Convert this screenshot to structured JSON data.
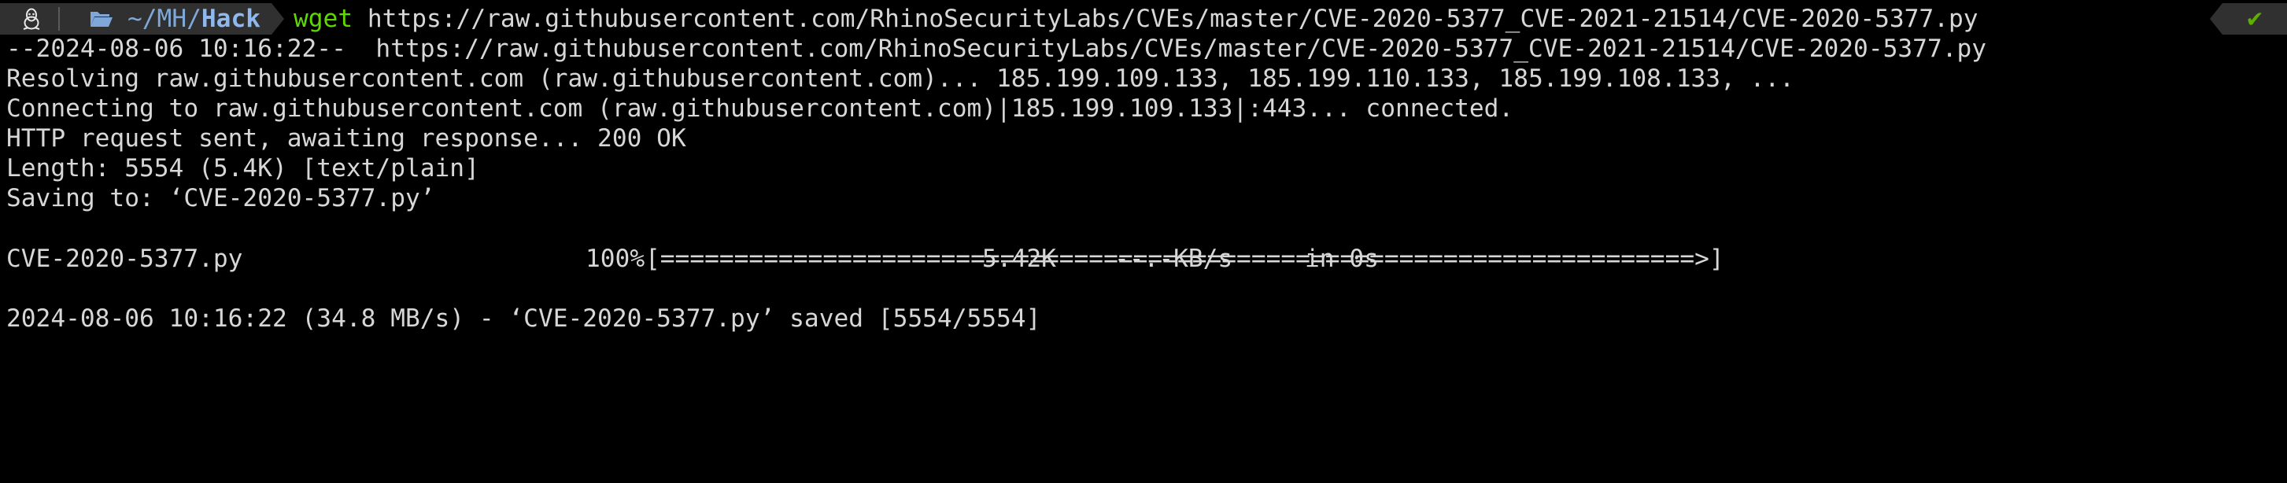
{
  "prompt": {
    "dir_prefix": "~/MH/",
    "dir_current": "Hack",
    "command": "wget",
    "argument": "https://raw.githubusercontent.com/RhinoSecurityLabs/CVEs/master/CVE-2020-5377_CVE-2021-21514/CVE-2020-5377.py",
    "status_icon": "checkmark-icon",
    "status_glyph": "✔",
    "os_icon": "linux-tux-icon",
    "folder_icon": "folder-open-icon"
  },
  "output": {
    "line1": "--2024-08-06 10:16:22--  https://raw.githubusercontent.com/RhinoSecurityLabs/CVEs/master/CVE-2020-5377_CVE-2021-21514/CVE-2020-5377.py",
    "line2": "Resolving raw.githubusercontent.com (raw.githubusercontent.com)... 185.199.109.133, 185.199.110.133, 185.199.108.133, ...",
    "line3": "Connecting to raw.githubusercontent.com (raw.githubusercontent.com)|185.199.109.133|:443... connected.",
    "line4": "HTTP request sent, awaiting response... 200 OK",
    "line5": "Length: 5554 (5.4K) [text/plain]",
    "line6": "Saving to: ‘CVE-2020-5377.py’",
    "progress": {
      "filename": "CVE-2020-5377.py",
      "percent": "100%",
      "bar": "[======================================================================>]",
      "size": "5.42K",
      "speed": "--.-KB/s",
      "time": "in 0s"
    },
    "line_saved": "2024-08-06 10:16:22 (34.8 MB/s) - ‘CVE-2020-5377.py’ saved [5554/5554]"
  },
  "colors": {
    "background": "#000000",
    "text": "#d7d7d7",
    "command": "#5fd700",
    "dir": "#7fa8d8",
    "segment_bg": "#303030",
    "ok": "#5faf00"
  }
}
